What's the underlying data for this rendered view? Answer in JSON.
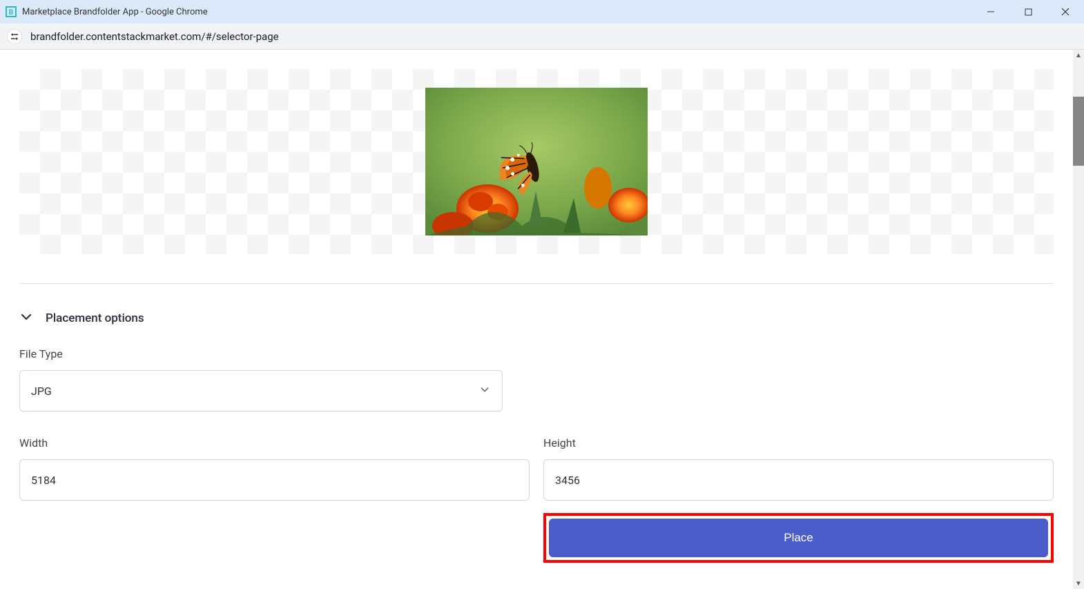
{
  "window": {
    "title": "Marketplace Brandfolder App - Google Chrome"
  },
  "addressbar": {
    "url": "brandfolder.contentstackmarket.com/#/selector-page"
  },
  "section": {
    "title": "Placement options"
  },
  "form": {
    "fileTypeLabel": "File Type",
    "fileTypeValue": "JPG",
    "widthLabel": "Width",
    "widthValue": "5184",
    "heightLabel": "Height",
    "heightValue": "3456",
    "placeLabel": "Place"
  }
}
